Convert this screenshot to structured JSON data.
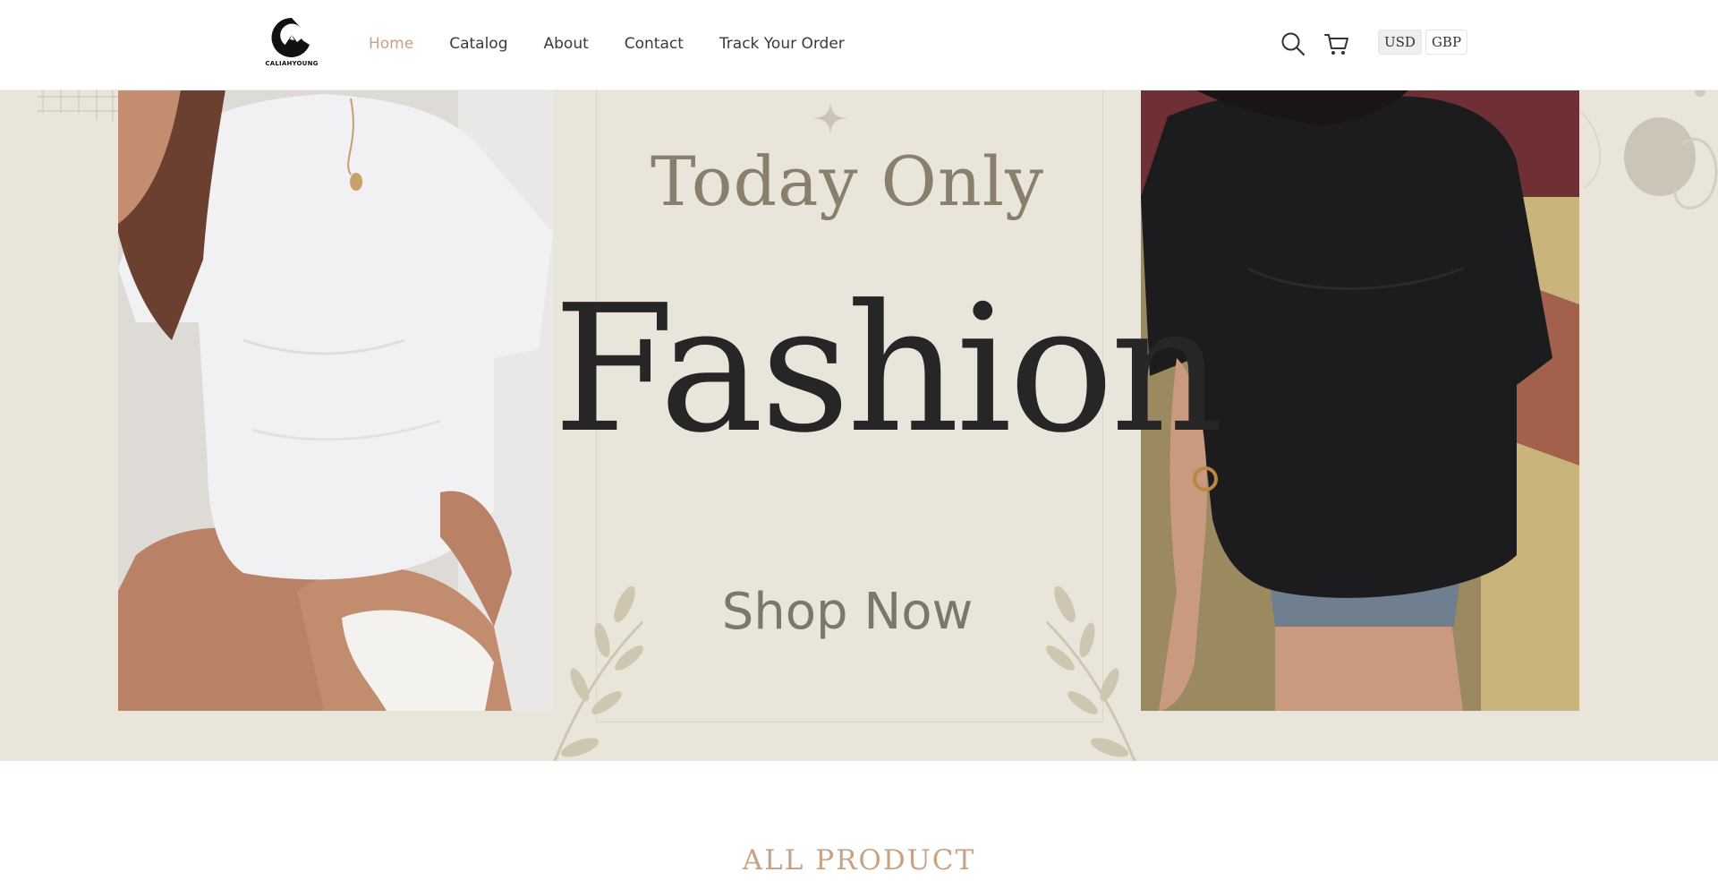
{
  "brand": {
    "name": "CALIAHYOUNG",
    "logo_icon": "mountain-c-logo-icon"
  },
  "nav": {
    "items": [
      {
        "label": "Home",
        "active": true
      },
      {
        "label": "Catalog",
        "active": false
      },
      {
        "label": "About",
        "active": false
      },
      {
        "label": "Contact",
        "active": false
      },
      {
        "label": "Track Your Order",
        "active": false
      }
    ]
  },
  "header_icons": {
    "search": "search-icon",
    "cart": "cart-icon"
  },
  "currency": {
    "options": [
      "USD",
      "GBP"
    ],
    "selected": "USD"
  },
  "hero": {
    "headline_top": "Today Only",
    "headline_main": "Fashion",
    "cta_label": "Shop Now",
    "left_photo_alt": "model in white oversized t-shirt",
    "right_photo_alt": "model in black oversized t-shirt"
  },
  "sections": {
    "all_product_title": "ALL PRODUCT"
  },
  "colors": {
    "accent": "#c9a184",
    "hero_background": "#e9e5da",
    "headline_muted": "#8a7f6c",
    "headline_dark": "#262626"
  }
}
